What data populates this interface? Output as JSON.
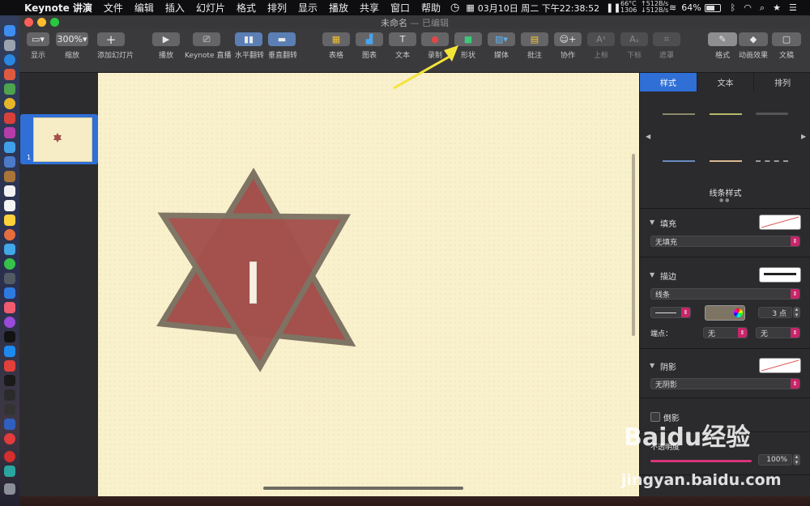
{
  "menubar": {
    "app_name": "Keynote 讲演",
    "menus": [
      "文件",
      "编辑",
      "插入",
      "幻灯片",
      "格式",
      "排列",
      "显示",
      "播放",
      "共享",
      "窗口",
      "帮助"
    ],
    "datetime": "03月10日 周二 下午22:38:52",
    "temp_top": "66°C",
    "temp_bottom": "1306",
    "net_up": "↑512B/s",
    "net_down": "↓512B/s",
    "battery": "64%"
  },
  "window": {
    "title": "未命名",
    "status": "— 已编辑"
  },
  "toolbar": {
    "zoom": "300%",
    "items": [
      {
        "label": "显示",
        "btn": "▭",
        "disabled": false
      },
      {
        "label": "缩放",
        "btn": "300%",
        "disabled": false
      },
      {
        "label": "添加幻灯片",
        "btn": "+",
        "disabled": false
      },
      {
        "label": "播放",
        "btn": "▶",
        "disabled": false
      },
      {
        "label": "Keynote 直播",
        "btn": "⎚",
        "disabled": false
      },
      {
        "label": "水平翻转",
        "btn": "▮▮",
        "disabled": false
      },
      {
        "label": "垂直翻转",
        "btn": "▬",
        "disabled": false
      },
      {
        "label": "表格",
        "btn": "▦",
        "disabled": false
      },
      {
        "label": "图表",
        "btn": "▟",
        "disabled": false
      },
      {
        "label": "文本",
        "btn": "T",
        "disabled": false
      },
      {
        "label": "录制",
        "btn": "●",
        "disabled": false
      },
      {
        "label": "形状",
        "btn": "■",
        "disabled": false
      },
      {
        "label": "媒体",
        "btn": "▨",
        "disabled": false
      },
      {
        "label": "批注",
        "btn": "▤",
        "disabled": false
      },
      {
        "label": "协作",
        "btn": "☺",
        "disabled": false
      },
      {
        "label": "上标",
        "btn": "Aˢ",
        "disabled": true
      },
      {
        "label": "下标",
        "btn": "Aₛ",
        "disabled": true
      },
      {
        "label": "遮罩",
        "btn": "⌗",
        "disabled": true
      },
      {
        "label": "格式",
        "btn": "✎",
        "disabled": false
      },
      {
        "label": "动画效果",
        "btn": "◆",
        "disabled": false
      },
      {
        "label": "文稿",
        "btn": "▢",
        "disabled": false
      }
    ]
  },
  "slide_nav": {
    "slide_number": "1"
  },
  "canvas": {
    "shape": "star-of-david",
    "fill_color": "#a4504c",
    "stroke_color": "#7d7464",
    "text_cursor": "I"
  },
  "inspector": {
    "tabs": [
      "样式",
      "文本",
      "排列"
    ],
    "line_style_title": "线条样式",
    "fill_label": "填充",
    "fill_value": "无填充",
    "stroke_label": "描边",
    "stroke_value": "线条",
    "stroke_width": "3 点",
    "endpoints_label": "端点：",
    "endpoint_left": "无",
    "endpoint_right": "无",
    "shadow_label": "阴影",
    "shadow_value": "无阴影",
    "reflection_label": "倒影",
    "opacity_label": "不透明度",
    "opacity_value": "100%",
    "accent_color": "#2f6fd6"
  },
  "watermark": {
    "brand": "Baidu经验",
    "url": "jingyan.baidu.com"
  }
}
